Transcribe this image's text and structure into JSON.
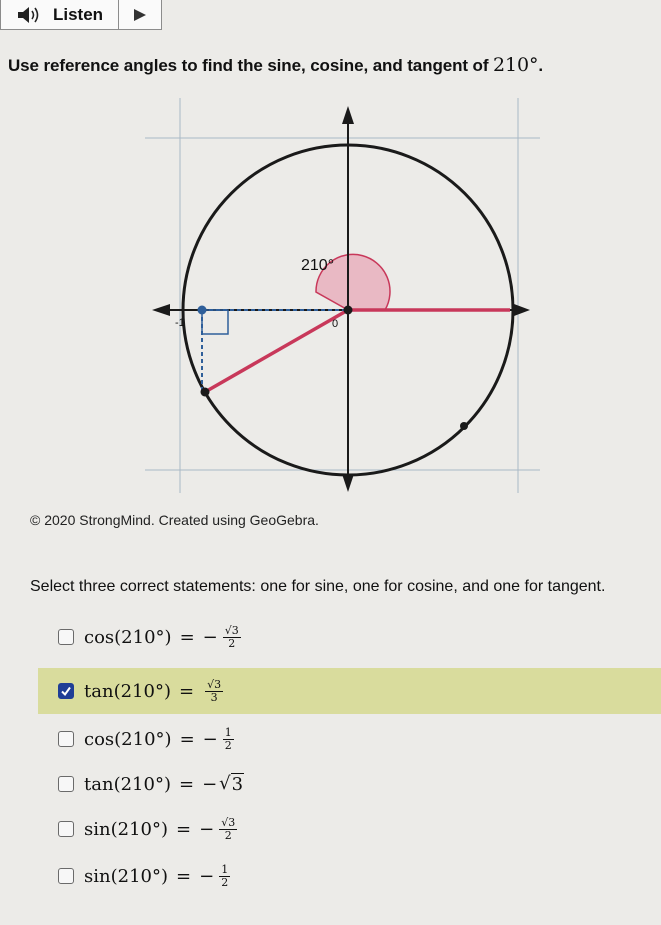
{
  "toolbar": {
    "listen_label": "Listen",
    "speaker_icon": "speaker-icon",
    "play_icon": "play-icon"
  },
  "question": {
    "prefix": "Use reference angles to find the sine, cosine, and tangent of ",
    "angle": "210°",
    "suffix": "."
  },
  "figure": {
    "angle_label": "210°",
    "x_tick_label": "-1",
    "origin_label": "0",
    "colors": {
      "terminal_ray": "#c8385a",
      "angle_fill": "#e9b9c4",
      "projection": "#2f5f9a",
      "circle": "#1a1a1a",
      "grid": "#a9b8c6"
    }
  },
  "credit": "© 2020 StrongMind. Created using GeoGebra.",
  "instruction": "Select three correct statements: one for sine, one for cosine, and one for tangent.",
  "options": [
    {
      "fn": "cos",
      "arg": "(210°)",
      "sign": "−",
      "numerator": "√3",
      "denominator": "2",
      "checked": false
    },
    {
      "fn": "tan",
      "arg": "(210°)",
      "sign": "",
      "numerator": "√3",
      "denominator": "3",
      "checked": true
    },
    {
      "fn": "cos",
      "arg": "(210°)",
      "sign": "−",
      "numerator": "1",
      "denominator": "2",
      "checked": false
    },
    {
      "fn": "tan",
      "arg": "(210°)",
      "sign": "−",
      "radicand": "3",
      "checked": false
    },
    {
      "fn": "sin",
      "arg": "(210°)",
      "sign": "−",
      "numerator": "√3",
      "denominator": "2",
      "checked": false
    },
    {
      "fn": "sin",
      "arg": "(210°)",
      "sign": "−",
      "numerator": "1",
      "denominator": "2",
      "checked": false
    }
  ]
}
